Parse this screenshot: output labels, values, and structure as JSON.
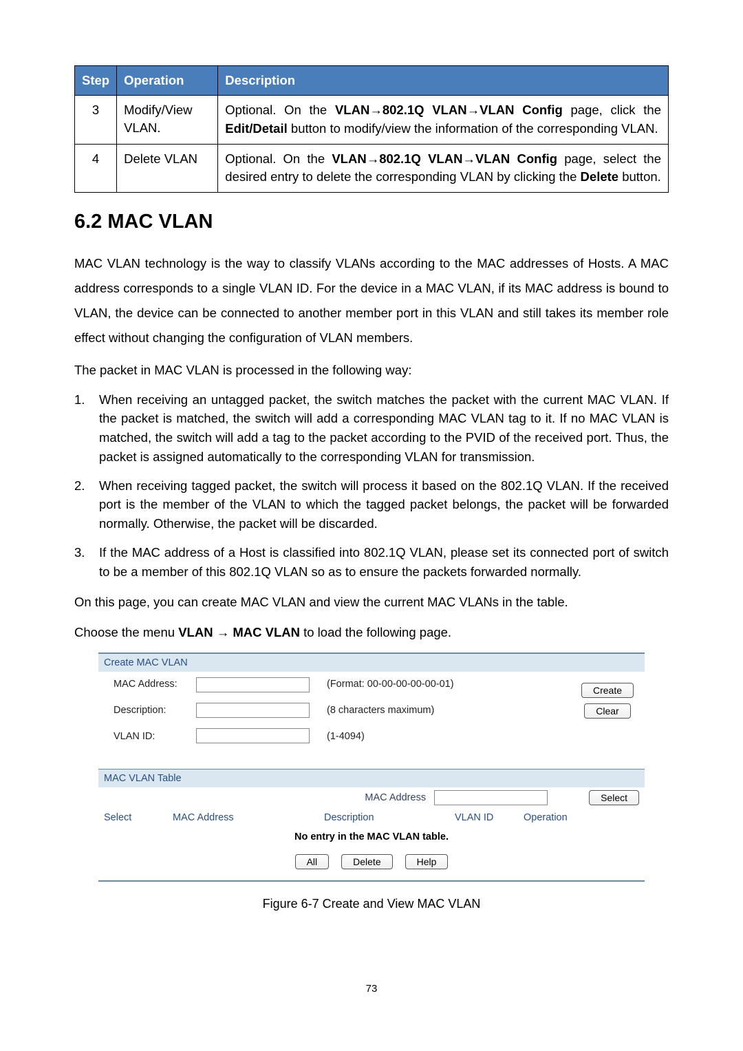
{
  "step_table": {
    "headers": {
      "step": "Step",
      "operation": "Operation",
      "description": "Description"
    },
    "rows": [
      {
        "step": "3",
        "operation": "Modify/View VLAN.",
        "desc_pre": "Optional. On the ",
        "desc_bold1": "VLAN→802.1Q VLAN→VLAN Config",
        "desc_mid1": " page, click the ",
        "desc_bold2": "Edit/Detail",
        "desc_post": " button to modify/view the information of the corresponding VLAN."
      },
      {
        "step": "4",
        "operation": "Delete VLAN",
        "desc_pre": "Optional. On the ",
        "desc_bold1": "VLAN→802.1Q VLAN→VLAN Config",
        "desc_mid1": " page, select the desired entry to delete the corresponding VLAN by clicking the ",
        "desc_bold2": "Delete",
        "desc_post": " button."
      }
    ]
  },
  "heading": "6.2   MAC VLAN",
  "para1": "MAC VLAN technology is the way to classify VLANs according to the MAC addresses of Hosts. A MAC address corresponds to a single VLAN ID. For the device in a MAC VLAN, if its MAC address is bound to VLAN, the device can be connected to another member port in this VLAN and still takes its member role effect without changing the configuration of VLAN members.",
  "para2": "The packet in MAC VLAN is processed in the following way:",
  "list": [
    "When receiving an untagged packet, the switch matches the packet with the current MAC VLAN. If the packet is matched, the switch will add a corresponding MAC VLAN tag to it. If no MAC VLAN is matched, the switch will add a tag to the packet according to the PVID of the received port. Thus, the packet is assigned automatically to the corresponding VLAN for transmission.",
    "When receiving tagged packet, the switch will process it based on the 802.1Q VLAN. If the received port is the member of the VLAN to which the tagged packet belongs, the packet will be forwarded normally. Otherwise, the packet will be discarded.",
    "If the MAC address of a Host is classified into 802.1Q VLAN, please set its connected port of switch to be a member of this 802.1Q VLAN so as to ensure the packets forwarded normally."
  ],
  "para3": "On this page, you can create MAC VLAN and view the current MAC VLANs in the table.",
  "para4_pre": "Choose the menu ",
  "para4_bold": "VLAN → MAC VLAN",
  "para4_post": " to load the following page.",
  "panel": {
    "section1": "Create MAC VLAN",
    "section2": "MAC VLAN Table",
    "labels": {
      "mac": "MAC Address:",
      "desc": "Description:",
      "vlan": "VLAN ID:"
    },
    "hints": {
      "mac": "(Format: 00-00-00-00-00-01)",
      "desc": "(8 characters maximum)",
      "vlan": "(1-4094)"
    },
    "buttons": {
      "create": "Create",
      "clear": "Clear",
      "select": "Select",
      "all": "All",
      "delete": "Delete",
      "help": "Help"
    },
    "filter_label": "MAC Address",
    "columns": {
      "select": "Select",
      "mac": "MAC Address",
      "desc": "Description",
      "vlan": "VLAN ID",
      "op": "Operation"
    },
    "empty": "No entry in the MAC VLAN table."
  },
  "caption": "Figure 6-7 Create and View MAC VLAN",
  "page_number": "73"
}
